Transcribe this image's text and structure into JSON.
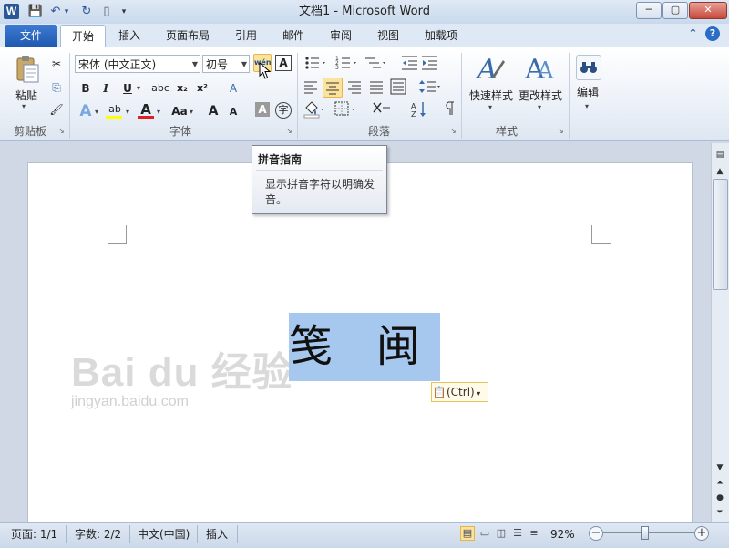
{
  "window": {
    "title": "文档1 - Microsoft Word",
    "app_icon": "W",
    "minimize": "─",
    "maximize": "▢",
    "close": "✕"
  },
  "quick_access": {
    "save_icon": "💾",
    "undo_icon": "↶",
    "undo_dropdown": "▾",
    "redo_icon": "↻",
    "new_icon": "▯",
    "customize_icon": "▾"
  },
  "tabs": [
    "文件",
    "开始",
    "插入",
    "页面布局",
    "引用",
    "邮件",
    "审阅",
    "视图",
    "加载项"
  ],
  "ribbon_right": {
    "help": "?",
    "collapse": "⌃"
  },
  "clipboard": {
    "paste_label": "粘贴",
    "cut_icon": "✂",
    "copy_icon": "⎘",
    "format_painter_icon": "🖌",
    "group_label": "剪贴板"
  },
  "font": {
    "font_name": "宋体 (中文正文)",
    "font_size": "初号",
    "pinyin_label": "wén",
    "char_border_label": "A",
    "bold": "B",
    "italic": "I",
    "underline": "U",
    "strike": "abc",
    "subscript": "x₂",
    "superscript": "x²",
    "clear_format": "A",
    "text_effect": "A",
    "highlight": "ab",
    "font_color": "A",
    "change_case": "Aa",
    "grow": "A",
    "shrink": "A",
    "char_shading": "A",
    "enclose": "字",
    "group_label": "字体"
  },
  "paragraph": {
    "group_label": "段落"
  },
  "styles": {
    "quick_styles": "快速样式",
    "change_styles": "更改样式",
    "group_label": "样式"
  },
  "editing": {
    "label": "编辑"
  },
  "tooltip": {
    "title": "拼音指南",
    "body": "显示拼音字符以明确发音。"
  },
  "document": {
    "selected_text": "笺　闽",
    "paste_options": "(Ctrl)",
    "watermark_brand": "Bai du 经验",
    "watermark_url": "jingyan.baidu.com"
  },
  "status": {
    "page": "页面: 1/1",
    "words": "字数: 2/2",
    "language": "中文(中国)",
    "mode": "插入",
    "zoom": "92%",
    "zoom_fraction": 0.45
  },
  "colors": {
    "file_tab": "#1f58b0",
    "selection": "#a6c7ee",
    "highlight_btn": "#fbe39c",
    "font_color_bar": "#e02020",
    "highlight_bar": "#ffff00"
  }
}
